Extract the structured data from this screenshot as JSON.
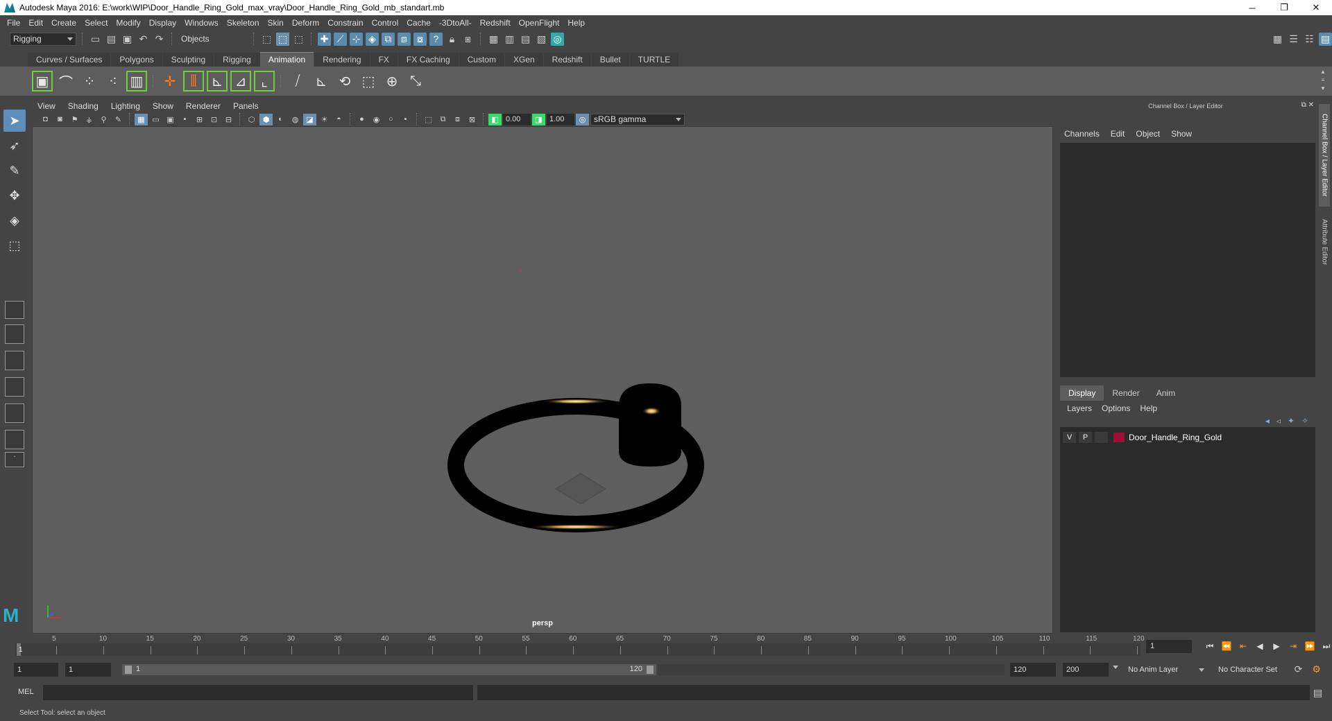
{
  "window": {
    "title": "Autodesk Maya 2016: E:\\work\\WIP\\Door_Handle_Ring_Gold_max_vray\\Door_Handle_Ring_Gold_mb_standart.mb",
    "minimize": "─",
    "restore": "❐",
    "close": "✕"
  },
  "menubar": [
    "File",
    "Edit",
    "Create",
    "Select",
    "Modify",
    "Display",
    "Windows",
    "Skeleton",
    "Skin",
    "Deform",
    "Constrain",
    "Control",
    "Cache",
    "-3DtoAll-",
    "Redshift",
    "OpenFlight",
    "Help"
  ],
  "statusline": {
    "mode": "Rigging",
    "selection_mode": "Objects"
  },
  "shelf": {
    "tabs": [
      "Curves / Surfaces",
      "Polygons",
      "Sculpting",
      "Rigging",
      "Animation",
      "Rendering",
      "FX",
      "FX Caching",
      "Custom",
      "XGen",
      "Redshift",
      "Bullet",
      "TURTLE"
    ],
    "active_tab": "Animation"
  },
  "viewport": {
    "menus": [
      "View",
      "Shading",
      "Lighting",
      "Show",
      "Renderer",
      "Panels"
    ],
    "exposure": "0.00",
    "gamma": "1.00",
    "color_space": "sRGB gamma",
    "camera_label": "persp"
  },
  "right_panel": {
    "title": "Channel Box / Layer Editor",
    "channel_menu": [
      "Channels",
      "Edit",
      "Object",
      "Show"
    ],
    "layer_tabs": [
      "Display",
      "Render",
      "Anim"
    ],
    "active_layer_tab": "Display",
    "layer_menu": [
      "Layers",
      "Options",
      "Help"
    ],
    "layers": [
      {
        "visible": "V",
        "playback": "P",
        "name": "Door_Handle_Ring_Gold",
        "color": "#9b1034"
      }
    ],
    "vertical_tabs": [
      "Channel Box / Layer Editor",
      "Attribute Editor"
    ]
  },
  "timeline": {
    "ticks": [
      "5",
      "10",
      "15",
      "20",
      "25",
      "30",
      "35",
      "40",
      "45",
      "50",
      "55",
      "60",
      "65",
      "70",
      "75",
      "80",
      "85",
      "90",
      "95",
      "100",
      "105",
      "110",
      "115",
      "120"
    ],
    "start_label": "1",
    "current_frame": "1"
  },
  "range": {
    "start_time": "1",
    "playback_start": "1",
    "slider_start": "1",
    "slider_end": "120",
    "playback_end": "120",
    "end_time": "200",
    "anim_layer": "No Anim Layer",
    "character_set": "No Character Set"
  },
  "command": {
    "label": "MEL"
  },
  "help_line": "Select Tool: select an object"
}
